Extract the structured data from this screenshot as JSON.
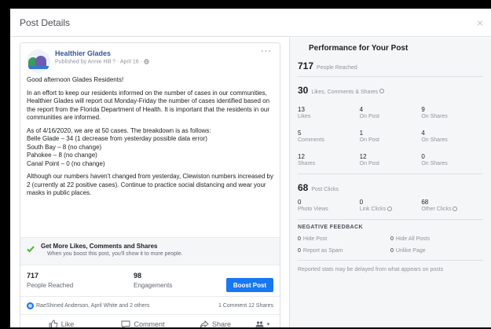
{
  "modal": {
    "title": "Post Details",
    "close": "×"
  },
  "post": {
    "page_name": "Healthier Glades",
    "meta": "Published by Annie Hill ? · April 16 · ",
    "more": "···",
    "greeting": "Good afternoon Glades Residents!",
    "para1": "In an effort to keep our residents informed on the number of cases in our communities, Healthier Glades will report out Monday-Friday the number of cases identified based on the report from the Florida Department of Health. It is important that the residents in our communities are informed.",
    "para2_lines": [
      "As of 4/16/2020, we are at 50 cases. The breakdown is as follows:",
      "Belle Glade – 34 (1 decrease from yesterday possible data error)",
      "South Bay – 8 (no change)",
      "Pahokee – 8 (no change)",
      "Canal Point – 0 (no change)"
    ],
    "para3": "Although our numbers haven't changed from yesterday, Clewiston numbers increased by 2 (currently at 22 positive cases). Continue to practice social distancing and wear your masks in public places.",
    "boost_title": "Get More Likes, Comments and Shares",
    "boost_sub": "When you boost this post, you'll show it to more people.",
    "reached_num": "717",
    "reached_lbl": "People Reached",
    "engage_num": "98",
    "engage_lbl": "Engagements",
    "boost_btn": "Boost Post",
    "reactors": "RaeShined Anderson, April White and 2 others",
    "counts": "1 Comment  12 Shares",
    "like": "Like",
    "comment": "Comment",
    "share": "Share",
    "audience": "▾"
  },
  "perf": {
    "title": "Performance for Your Post",
    "reached_num": "717",
    "reached_lbl": "People Reached",
    "lcs_num": "30",
    "lcs_lbl": "Likes, Comments & Shares",
    "grid": [
      {
        "n": "13",
        "l": "Likes"
      },
      {
        "n": "4",
        "l": "On Post"
      },
      {
        "n": "9",
        "l": "On Shares"
      },
      {
        "n": "5",
        "l": "Comments"
      },
      {
        "n": "1",
        "l": "On Post"
      },
      {
        "n": "4",
        "l": "On Shares"
      },
      {
        "n": "12",
        "l": "Shares"
      },
      {
        "n": "12",
        "l": "On Post"
      },
      {
        "n": "0",
        "l": "On Shares"
      }
    ],
    "clicks_num": "68",
    "clicks_lbl": "Post Clicks",
    "clicks": [
      {
        "n": "0",
        "l": "Photo Views"
      },
      {
        "n": "0",
        "l": "Link Clicks"
      },
      {
        "n": "68",
        "l": "Other Clicks"
      }
    ],
    "neg_head": "NEGATIVE FEEDBACK",
    "neg": [
      {
        "n": "0",
        "l": "Hide Post"
      },
      {
        "n": "0",
        "l": "Hide All Posts"
      },
      {
        "n": "0",
        "l": "Report as Spam"
      },
      {
        "n": "0",
        "l": "Unlike Page"
      }
    ],
    "note": "Reported stats may be delayed from what appears on posts"
  }
}
